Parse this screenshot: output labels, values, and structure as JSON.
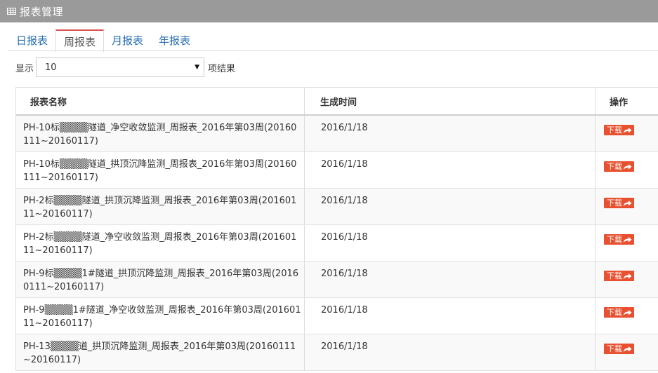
{
  "header": {
    "title": "报表管理",
    "icon": "grid-icon"
  },
  "tabs": [
    {
      "label": "日报表",
      "active": false
    },
    {
      "label": "周报表",
      "active": true
    },
    {
      "label": "月报表",
      "active": false
    },
    {
      "label": "年报表",
      "active": false
    }
  ],
  "length_control": {
    "prefix": "显示",
    "selected": "10",
    "suffix": "项结果"
  },
  "table": {
    "columns": [
      "报表名称",
      "生成时间",
      "操作"
    ],
    "download_label": "下载",
    "rows": [
      {
        "name": "PH-10标▒▒▒▒隧道_净空收敛监测_周报表_2016年第03周(20160111~20160117)",
        "time": "2016/1/18"
      },
      {
        "name": "PH-10标▒▒▒▒隧道_拱顶沉降监测_周报表_2016年第03周(20160111~20160117)",
        "time": "2016/1/18"
      },
      {
        "name": "PH-2标▒▒▒▒隧道_拱顶沉降监测_周报表_2016年第03周(20160111~20160117)",
        "time": "2016/1/18"
      },
      {
        "name": "PH-2标▒▒▒▒隧道_净空收敛监测_周报表_2016年第03周(20160111~20160117)",
        "time": "2016/1/18"
      },
      {
        "name": "PH-9标▒▒▒▒1#隧道_拱顶沉降监测_周报表_2016年第03周(20160111~20160117)",
        "time": "2016/1/18"
      },
      {
        "name": "PH-9▒▒▒▒1#隧道_净空收敛监测_周报表_2016年第03周(20160111~20160117)",
        "time": "2016/1/18"
      },
      {
        "name": "PH-13▒▒▒▒道_拱顶沉降监测_周报表_2016年第03周(20160111~20160117)",
        "time": "2016/1/18"
      }
    ]
  },
  "colors": {
    "header_bg": "#9a9a9a",
    "tab_active_accent": "#d9534f",
    "tab_link": "#2a6fb0",
    "download_bg": "#e8502f"
  }
}
